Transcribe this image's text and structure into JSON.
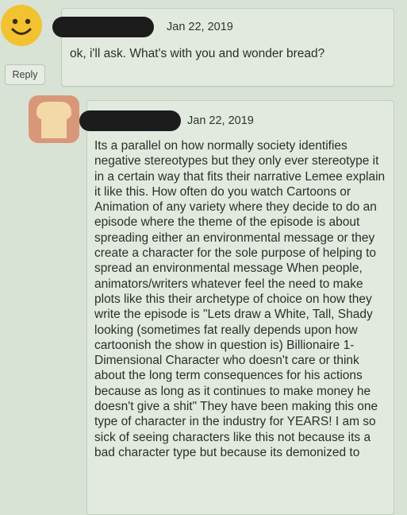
{
  "comments": [
    {
      "avatar": "smiley-face-avatar",
      "date": "Jan 22, 2019",
      "text": "ok, i'll ask. What's with you and wonder bread?",
      "reply_label": "Reply"
    },
    {
      "avatar": "bread-toast-avatar",
      "date": "Jan 22, 2019",
      "text": "Its a parallel on how normally society identifies negative stereotypes but they only ever stereotype it in a certain way that fits their narrative Lemee explain it like this. How often do you watch Cartoons or Animation of any variety where they decide to do an episode where the theme of the episode is about spreading either an environmental message or they create a character for the sole purpose of helping to spread an environmental message When people, animators/writers whatever feel the need to make plots like this their archetype of choice on how they write the episode is \"Lets draw a White, Tall, Shady looking (sometimes fat really depends upon how cartoonish the show in question is) Billionaire 1-Dimensional Character who doesn't care or think about the long term consequences for his actions because as long as it continues to make money he doesn't give a shit\" They have been making this one type of character in the industry for YEARS! I am so sick of seeing characters like this not because its a bad character type but because its demonized to"
    }
  ],
  "colors": {
    "background": "#d9e3d5",
    "bubble": "#e2eadf",
    "redaction": "#1c1c1c",
    "smiley": "#f2c230",
    "bread_crust": "#d9977a",
    "bread_crumb": "#f4d9a8"
  }
}
